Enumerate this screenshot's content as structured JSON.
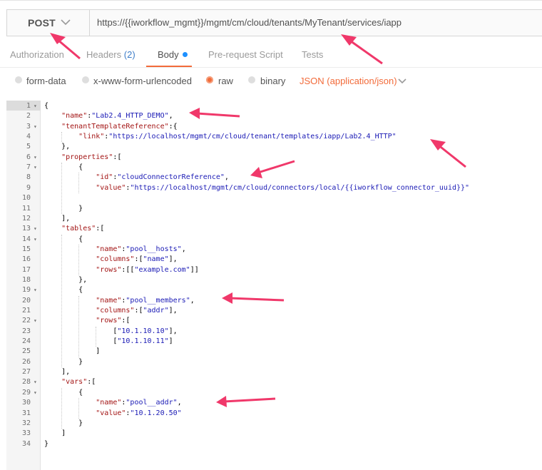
{
  "request": {
    "method": "POST",
    "url": "https://{{iworkflow_mgmt}}/mgmt/cm/cloud/tenants/MyTenant/services/iapp"
  },
  "tabs": {
    "authorization": "Authorization",
    "headers": "Headers",
    "headers_count": "(2)",
    "body": "Body",
    "prerequest": "Pre-request Script",
    "tests": "Tests"
  },
  "body_options": {
    "form_data": "form-data",
    "urlencoded": "x-www-form-urlencoded",
    "raw": "raw",
    "binary": "binary",
    "content_type": "JSON (application/json)"
  },
  "editor": {
    "line_numbers": [
      "1",
      "2",
      "3",
      "4",
      "5",
      "6",
      "7",
      "8",
      "9",
      "10",
      "11",
      "12",
      "13",
      "14",
      "15",
      "16",
      "17",
      "18",
      "19",
      "20",
      "21",
      "22",
      "23",
      "24",
      "25",
      "26",
      "27",
      "28",
      "29",
      "30",
      "31",
      "32",
      "33",
      "34"
    ],
    "code": [
      "{",
      "    \"name\":\"Lab2.4_HTTP_DEMO\",",
      "    \"tenantTemplateReference\":{",
      "        \"link\":\"https://localhost/mgmt/cm/cloud/tenant/templates/iapp/Lab2.4_HTTP\"",
      "    },",
      "    \"properties\":[",
      "        {",
      "            \"id\":\"cloudConnectorReference\",",
      "            \"value\":\"https://localhost/mgmt/cm/cloud/connectors/local/{{iworkflow_connector_uuid}}\"",
      "",
      "        }",
      "    ],",
      "    \"tables\":[",
      "        {",
      "            \"name\":\"pool__hosts\",",
      "            \"columns\":[\"name\"],",
      "            \"rows\":[[\"example.com\"]]",
      "        },",
      "        {",
      "            \"name\":\"pool__members\",",
      "            \"columns\":[\"addr\"],",
      "            \"rows\":[",
      "                [\"10.1.10.10\"],",
      "                [\"10.1.10.11\"]",
      "            ]",
      "        }",
      "    ],",
      "    \"vars\":[",
      "        {",
      "            \"name\":\"pool__addr\",",
      "            \"value\":\"10.1.20.50\"",
      "        }",
      "    ]",
      "}"
    ]
  },
  "colors": {
    "accent": "#f26b3a",
    "arrow": "#f0386a",
    "json_key": "#a31515",
    "json_string": "#1a1ab5"
  },
  "icons": [
    "chevron-down-icon",
    "radio-icon",
    "fold-arrow-icon",
    "annotation-arrow"
  ]
}
